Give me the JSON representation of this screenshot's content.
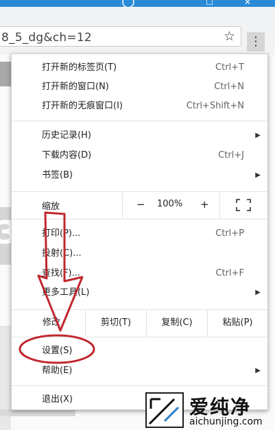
{
  "browser": {
    "address": "8_5_dg&ch=12",
    "menu_icon_name": "vertical-dots-icon",
    "star_icon_name": "bookmark-star-icon"
  },
  "menu": {
    "group1": [
      {
        "label": "打开新的标签页(T)",
        "shortcut": "Ctrl+T"
      },
      {
        "label": "打开新的窗口(N)",
        "shortcut": "Ctrl+N"
      },
      {
        "label": "打开新的无痕窗口(I)",
        "shortcut": "Ctrl+Shift+N"
      }
    ],
    "group2": [
      {
        "label": "历史记录(H)",
        "shortcut": ""
      },
      {
        "label": "下载内容(D)",
        "shortcut": "Ctrl+J"
      },
      {
        "label": "书签(B)",
        "shortcut": ""
      }
    ],
    "zoom": {
      "label": "缩放",
      "minus": "−",
      "level": "100%",
      "plus": "+"
    },
    "group3": [
      {
        "label": "打印(P)...",
        "shortcut": "Ctrl+P"
      },
      {
        "label": "投射(C)...",
        "shortcut": ""
      },
      {
        "label": "查找(F)...",
        "shortcut": "Ctrl+F"
      },
      {
        "label": "更多工具(L)",
        "shortcut": ""
      }
    ],
    "edit": {
      "label": "修改",
      "cut": "剪切(T)",
      "copy": "复制(C)",
      "paste": "粘贴(P)"
    },
    "group4": [
      {
        "label": "设置(S)"
      },
      {
        "label": "帮助(E)"
      }
    ],
    "exit": {
      "label": "退出(X)"
    }
  },
  "annotation": {
    "stroke_color": "#c0272d"
  },
  "watermark": {
    "title": "爱纯净",
    "subtitle": "aichunjing.com"
  }
}
